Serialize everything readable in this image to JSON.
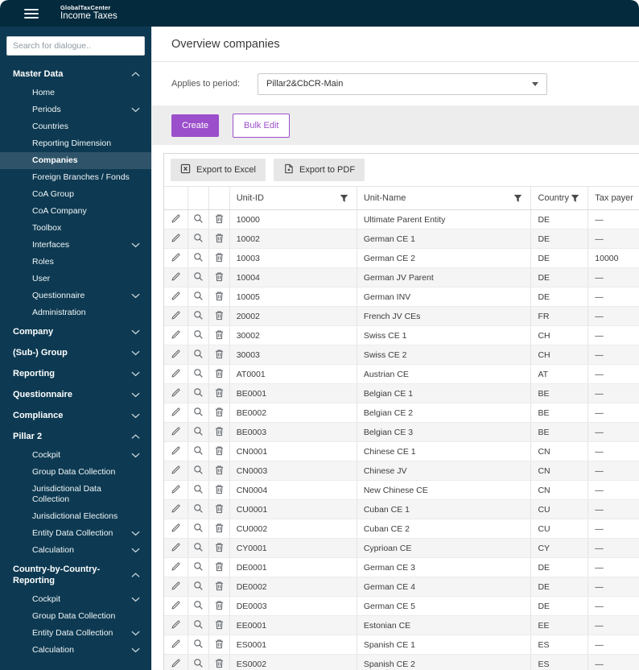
{
  "app": {
    "brand_small": "GlobalTaxCenter",
    "brand_large": "Income Taxes"
  },
  "colors": {
    "header_navy": "#042a3d",
    "sidebar_navy": "#0d3a52",
    "selected_item": "#2f5469",
    "accent_purple": "#9b4fcb",
    "strip_gray": "#ededed"
  },
  "sidebar": {
    "search_placeholder": "Search for dialogue..",
    "sections": [
      {
        "label": "Master Data",
        "chevron": "up",
        "items": [
          {
            "label": "Home"
          },
          {
            "label": "Periods",
            "chevron": "down"
          },
          {
            "label": "Countries"
          },
          {
            "label": "Reporting Dimension"
          },
          {
            "label": "Companies",
            "selected": true
          },
          {
            "label": "Foreign Branches / Fonds"
          },
          {
            "label": "CoA Group"
          },
          {
            "label": "CoA Company"
          },
          {
            "label": "Toolbox"
          },
          {
            "label": "Interfaces",
            "chevron": "down"
          },
          {
            "label": "Roles"
          },
          {
            "label": "User"
          },
          {
            "label": "Questionnaire",
            "chevron": "down"
          },
          {
            "label": "Administration"
          }
        ]
      },
      {
        "label": "Company",
        "chevron": "down",
        "items": []
      },
      {
        "label": "(Sub-) Group",
        "chevron": "down",
        "items": []
      },
      {
        "label": "Reporting",
        "chevron": "down",
        "items": []
      },
      {
        "label": "Questionnaire",
        "chevron": "down",
        "items": []
      },
      {
        "label": "Compliance",
        "chevron": "down",
        "items": []
      },
      {
        "label": "Pillar 2",
        "chevron": "up",
        "items": [
          {
            "label": "Cockpit",
            "chevron": "down"
          },
          {
            "label": "Group Data Collection"
          },
          {
            "label": "Jurisdictional Data Collection"
          },
          {
            "label": "Jurisdictional Elections"
          },
          {
            "label": "Entity Data Collection",
            "chevron": "down"
          },
          {
            "label": "Calculation",
            "chevron": "down"
          }
        ]
      },
      {
        "label": "Country-by-Country-Reporting",
        "chevron": "up",
        "items": [
          {
            "label": "Cockpit",
            "chevron": "down"
          },
          {
            "label": "Group Data Collection"
          },
          {
            "label": "Entity Data Collection",
            "chevron": "down"
          },
          {
            "label": "Calculation",
            "chevron": "down"
          }
        ]
      }
    ]
  },
  "main": {
    "title": "Overview companies",
    "period": {
      "label": "Applies to period:",
      "value": "Pillar2&CbCR-Main"
    },
    "actions": {
      "create": "Create",
      "bulk_edit": "Bulk Edit"
    },
    "export": {
      "excel": "Export to Excel",
      "pdf": "Export to PDF"
    },
    "table": {
      "columns": [
        {
          "label": "Unit-ID",
          "filter": true
        },
        {
          "label": "Unit-Name",
          "filter": true
        },
        {
          "label": "Country",
          "filter": true
        },
        {
          "label": "Tax payer",
          "filter": false
        }
      ],
      "row_actions": [
        "edit",
        "view",
        "delete"
      ],
      "rows": [
        [
          "10000",
          "Ultimate Parent Entity",
          "DE",
          "—"
        ],
        [
          "10002",
          "German CE 1",
          "DE",
          "—"
        ],
        [
          "10003",
          "German CE 2",
          "DE",
          "10000"
        ],
        [
          "10004",
          "German JV Parent",
          "DE",
          "—"
        ],
        [
          "10005",
          "German INV",
          "DE",
          "—"
        ],
        [
          "20002",
          "French JV CEs",
          "FR",
          "—"
        ],
        [
          "30002",
          "Swiss CE 1",
          "CH",
          "—"
        ],
        [
          "30003",
          "Swiss CE 2",
          "CH",
          "—"
        ],
        [
          "AT0001",
          "Austrian CE",
          "AT",
          "—"
        ],
        [
          "BE0001",
          "Belgian CE 1",
          "BE",
          "—"
        ],
        [
          "BE0002",
          "Belgian CE 2",
          "BE",
          "—"
        ],
        [
          "BE0003",
          "Belgian CE 3",
          "BE",
          "—"
        ],
        [
          "CN0001",
          "Chinese CE 1",
          "CN",
          "—"
        ],
        [
          "CN0003",
          "Chinese JV",
          "CN",
          "—"
        ],
        [
          "CN0004",
          "New Chinese CE",
          "CN",
          "—"
        ],
        [
          "CU0001",
          "Cuban CE 1",
          "CU",
          "—"
        ],
        [
          "CU0002",
          "Cuban CE 2",
          "CU",
          "—"
        ],
        [
          "CY0001",
          "Cyprioan CE",
          "CY",
          "—"
        ],
        [
          "DE0001",
          "German CE 3",
          "DE",
          "—"
        ],
        [
          "DE0002",
          "German CE 4",
          "DE",
          "—"
        ],
        [
          "DE0003",
          "German CE 5",
          "DE",
          "—"
        ],
        [
          "EE0001",
          "Estonian CE",
          "EE",
          "—"
        ],
        [
          "ES0001",
          "Spanish CE 1",
          "ES",
          "—"
        ],
        [
          "ES0002",
          "Spanish CE 2",
          "ES",
          "—"
        ]
      ]
    }
  }
}
